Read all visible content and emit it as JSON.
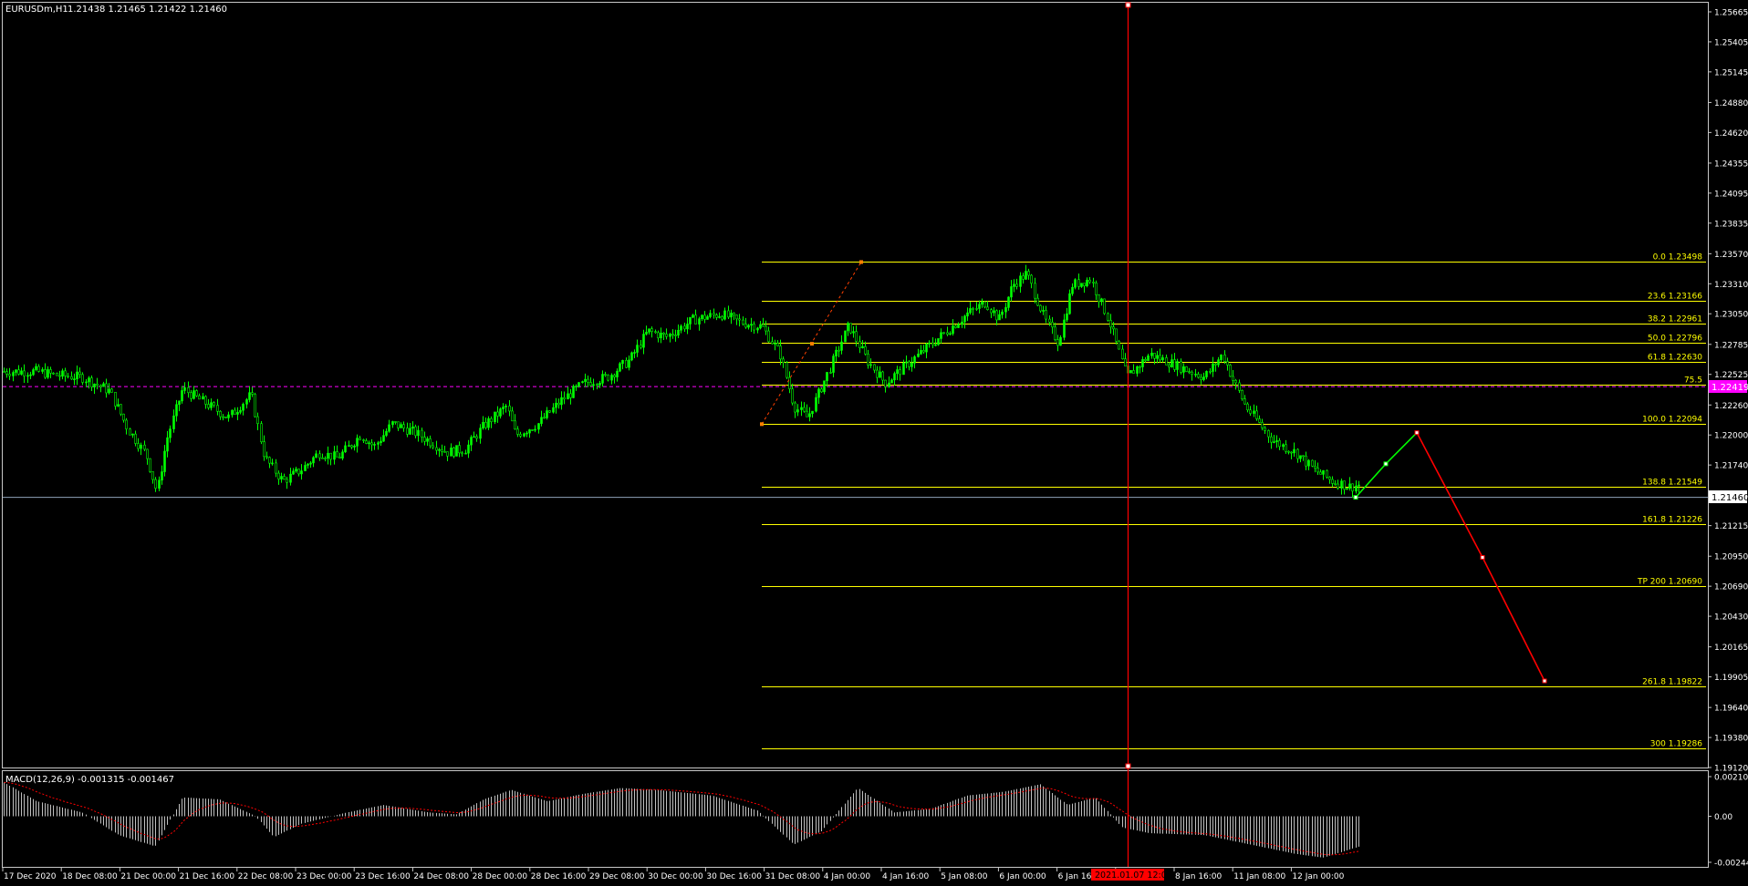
{
  "header": {
    "symbol_label": "EURUSDm,H1",
    "ohlc_label": "1.21438 1.21465 1.21422 1.21460"
  },
  "colors": {
    "background": "#000000",
    "frame": "#c8c8c8",
    "candle": "#00ff00",
    "fib": "#ffff00",
    "vline": "#ff0000",
    "prev_close_line": "#ff00ff",
    "bid_line": "#8fa3b8",
    "macd_hist": "#c0c0c0",
    "macd_signal": "#ff0000",
    "zigzag_up": "#00ff00",
    "zigzag_down": "#ff0000"
  },
  "price_axis": {
    "labels": [
      "1.25665",
      "1.25405",
      "1.25145",
      "1.24880",
      "1.24620",
      "1.24355",
      "1.24095",
      "1.23835",
      "1.23570",
      "1.23310",
      "1.23050",
      "1.22785",
      "1.22525",
      "1.22260",
      "1.22000",
      "1.21740",
      "1.21475",
      "1.21215",
      "1.20950",
      "1.20690",
      "1.20430",
      "1.20165",
      "1.19905",
      "1.19640",
      "1.19380",
      "1.19120"
    ],
    "min": 1.1912,
    "max": 1.25665,
    "current_bid": "1.21460",
    "marker_tag": "1.22419"
  },
  "time_axis": {
    "labels": [
      "17 Dec 2020",
      "18 Dec 08:00",
      "21 Dec 00:00",
      "21 Dec 16:00",
      "22 Dec 08:00",
      "23 Dec 00:00",
      "23 Dec 16:00",
      "24 Dec 08:00",
      "28 Dec 00:00",
      "28 Dec 16:00",
      "29 Dec 08:00",
      "30 Dec 00:00",
      "30 Dec 16:00",
      "31 Dec 08:00",
      "4 Jan 00:00",
      "4 Jan 16:00",
      "5 Jan 08:00",
      "6 Jan 00:00",
      "6 Jan 16:00",
      "8 Jan 00:00",
      "8 Jan 16:00",
      "11 Jan 08:00",
      "12 Jan 00:00"
    ],
    "cursor_time": "2021.01.07 12:00"
  },
  "fibonacci": {
    "levels": [
      {
        "label": "0.0 1.23498",
        "price": 1.23498
      },
      {
        "label": "23.6 1.23166",
        "price": 1.23166
      },
      {
        "label": "38.2 1.22961",
        "price": 1.22961
      },
      {
        "label": "50.0 1.22796",
        "price": 1.22796
      },
      {
        "label": "61.8 1.22630",
        "price": 1.2263
      },
      {
        "label": "75.5",
        "price": 1.22438
      },
      {
        "label": "100.0 1.22094",
        "price": 1.22094
      },
      {
        "label": "138.8 1.21549",
        "price": 1.21549
      },
      {
        "label": "161.8 1.21226",
        "price": 1.21226
      },
      {
        "label": "TP 200 1.20690",
        "price": 1.2069
      },
      {
        "label": "261.8 1.19822",
        "price": 1.19822
      },
      {
        "label": "300 1.19286",
        "price": 1.19286
      }
    ]
  },
  "reference_lines": {
    "prev_close_price": 1.22419,
    "bid_price": 1.2146
  },
  "zigzag": {
    "dashed_leg": [
      [
        1.22094,
        1.23498
      ]
    ],
    "projection_prices": [
      1.2146,
      1.2175,
      1.2202,
      1.2094,
      1.1987
    ]
  },
  "macd": {
    "label": "MACD(12,26,9) -0.001315 -0.001467",
    "axis_labels": [
      "0.002105",
      "0.00",
      "-0.002446"
    ],
    "max": 0.002105,
    "min": -0.002446
  }
}
